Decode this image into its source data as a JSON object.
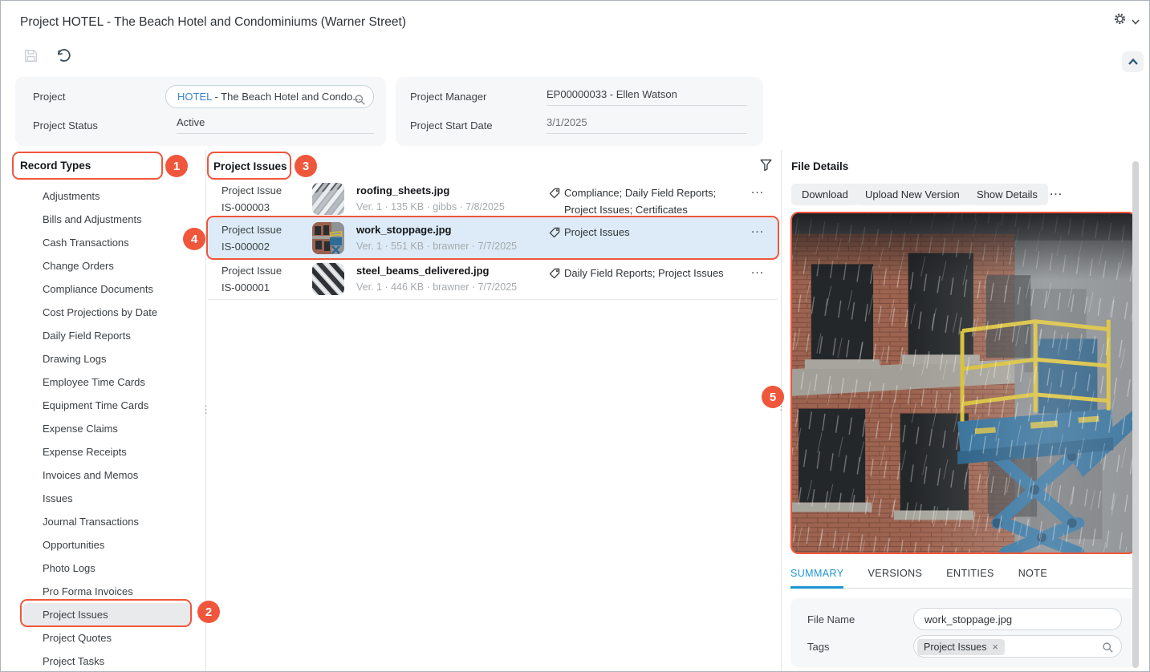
{
  "window": {
    "title": "Project HOTEL - The Beach Hotel and Condominiums (Warner Street)"
  },
  "summary": {
    "project_label": "Project",
    "project_code": "HOTEL",
    "project_rest": " - The Beach Hotel and Condo...",
    "project_status_label": "Project Status",
    "project_status_value": "Active",
    "project_manager_label": "Project Manager",
    "project_manager_value": "EP00000033 - Ellen Watson",
    "start_date_label": "Project Start Date",
    "start_date_value": "3/1/2025"
  },
  "record_types": {
    "title": "Record Types",
    "selected_item": "Project Issues",
    "items": [
      "Adjustments",
      "Bills and Adjustments",
      "Cash Transactions",
      "Change Orders",
      "Compliance Documents",
      "Cost Projections by Date",
      "Daily Field Reports",
      "Drawing Logs",
      "Employee Time Cards",
      "Equipment Time Cards",
      "Expense Claims",
      "Expense Receipts",
      "Invoices and Memos",
      "Issues",
      "Journal Transactions",
      "Opportunities",
      "Photo Logs",
      "Pro Forma Invoices",
      "Project Issues",
      "Project Quotes",
      "Project Tasks"
    ]
  },
  "issues_panel": {
    "title": "Project Issues",
    "more_label": "…",
    "rows": [
      {
        "record_type": "Project Issue",
        "record_id": "IS-000003",
        "file_name": "roofing_sheets.jpg",
        "meta": "Ver. 1 · 135 KB · gibbs · 7/8/2025",
        "tags": "Compliance; Daily Field Reports; Project Issues; Certificates",
        "selected": false
      },
      {
        "record_type": "Project Issue",
        "record_id": "IS-000002",
        "file_name": "work_stoppage.jpg",
        "meta": "Ver. 1 · 551 KB · brawner · 7/7/2025",
        "tags": "Project Issues",
        "selected": true
      },
      {
        "record_type": "Project Issue",
        "record_id": "IS-000001",
        "file_name": "steel_beams_delivered.jpg",
        "meta": "Ver. 1 · 446 KB · brawner · 7/7/2025",
        "tags": "Daily Field Reports; Project Issues",
        "selected": false
      }
    ]
  },
  "file_details": {
    "title": "File Details",
    "buttons": [
      "Download",
      "Upload New Version",
      "Show Details"
    ],
    "more_label": "…",
    "tabs": [
      "SUMMARY",
      "VERSIONS",
      "ENTITIES",
      "NOTE"
    ],
    "active_tab": "SUMMARY",
    "file_name_label": "File Name",
    "file_name_value": "work_stoppage.jpg",
    "tags_label": "Tags",
    "tag_chip": "Project Issues",
    "chip_close": "×"
  },
  "callouts": {
    "n1": "1",
    "n2": "2",
    "n3": "3",
    "n4": "4",
    "n5": "5"
  },
  "colors": {
    "accent": "#F0563B",
    "link_blue": "#3B87D0",
    "tab_active": "#1E95D2",
    "row_highlight": "#DCEBF7"
  }
}
